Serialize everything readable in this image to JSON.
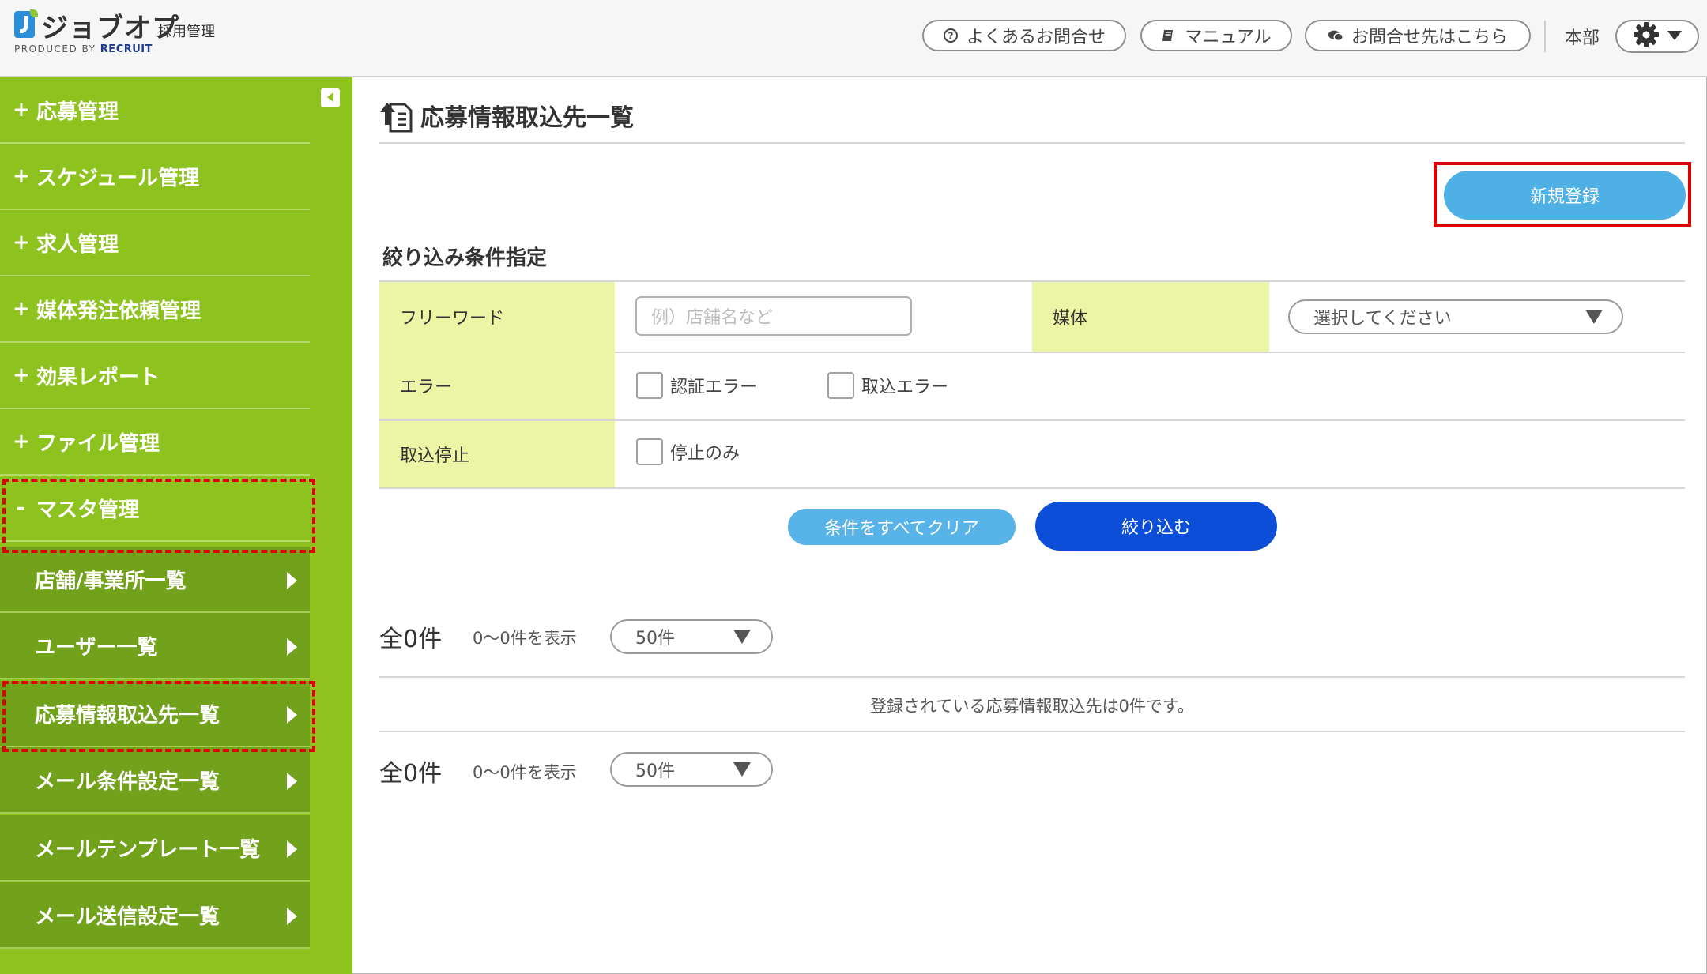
{
  "header": {
    "logo_text": "ジョブオプ",
    "logo_sub": "採用管理",
    "produced_by": "PRODUCED BY",
    "recruit": "RECRUIT",
    "faq": "よくあるお問合せ",
    "manual": "マニュアル",
    "contact": "お問合せ先はこちら",
    "org": "本部"
  },
  "sidebar": {
    "items": [
      {
        "sign": "+",
        "label": "応募管理"
      },
      {
        "sign": "+",
        "label": "スケジュール管理"
      },
      {
        "sign": "+",
        "label": "求人管理"
      },
      {
        "sign": "+",
        "label": "媒体発注依頼管理"
      },
      {
        "sign": "+",
        "label": "効果レポート"
      },
      {
        "sign": "+",
        "label": "ファイル管理"
      },
      {
        "sign": "-",
        "label": "マスタ管理"
      }
    ],
    "subitems": [
      {
        "label": "店舗/事業所一覧"
      },
      {
        "label": "ユーザー一覧"
      },
      {
        "label": "応募情報取込先一覧"
      },
      {
        "label": "メール条件設定一覧"
      },
      {
        "label": "メールテンプレート一覧"
      },
      {
        "label": "メール送信設定一覧"
      }
    ]
  },
  "main": {
    "title": "応募情報取込先一覧",
    "new_button": "新規登録",
    "filter_title": "絞り込み条件指定",
    "freeword_label": "フリーワード",
    "freeword_placeholder": "例）店舗名など",
    "media_label": "媒体",
    "media_select": "選択してください",
    "error_label": "エラー",
    "auth_error": "認証エラー",
    "import_error": "取込エラー",
    "stop_label": "取込停止",
    "stop_only": "停止のみ",
    "clear_button": "条件をすべてクリア",
    "filter_button": "絞り込む",
    "total": "全0件",
    "range": "0～0件を表示",
    "per_page": "50件",
    "empty_message": "登録されている応募情報取込先は0件です。"
  },
  "colors": {
    "sidebar": "#8dc21f",
    "subnav": "#72a11c",
    "filter_label_bg": "#ecf5a6",
    "primary": "#0d4ed9",
    "secondary": "#4fb0e6",
    "highlight": "#e00000"
  }
}
